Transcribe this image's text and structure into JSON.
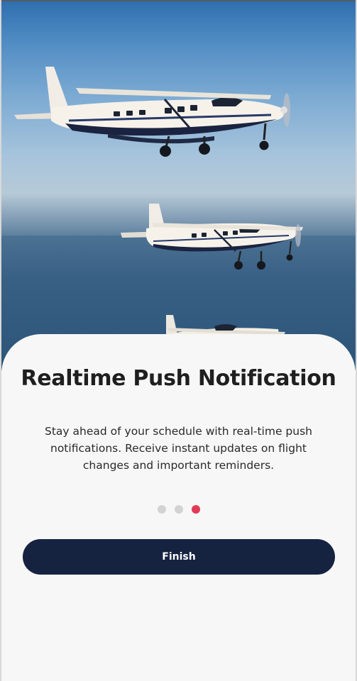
{
  "onboarding": {
    "hero_image": "three-cessna-caravan-aircraft-in-flight-over-sea",
    "title": "Realtime Push Notification",
    "description": "Stay ahead of your schedule with real-time push notifications. Receive instant updates on flight changes and important reminders.",
    "pager": {
      "total": 3,
      "active_index": 2
    },
    "finish_label": "Finish"
  },
  "colors": {
    "primary_button": "#152341",
    "active_dot": "#e23a55",
    "inactive_dot": "#d3d3d3",
    "sheet": "#f7f7f7"
  }
}
